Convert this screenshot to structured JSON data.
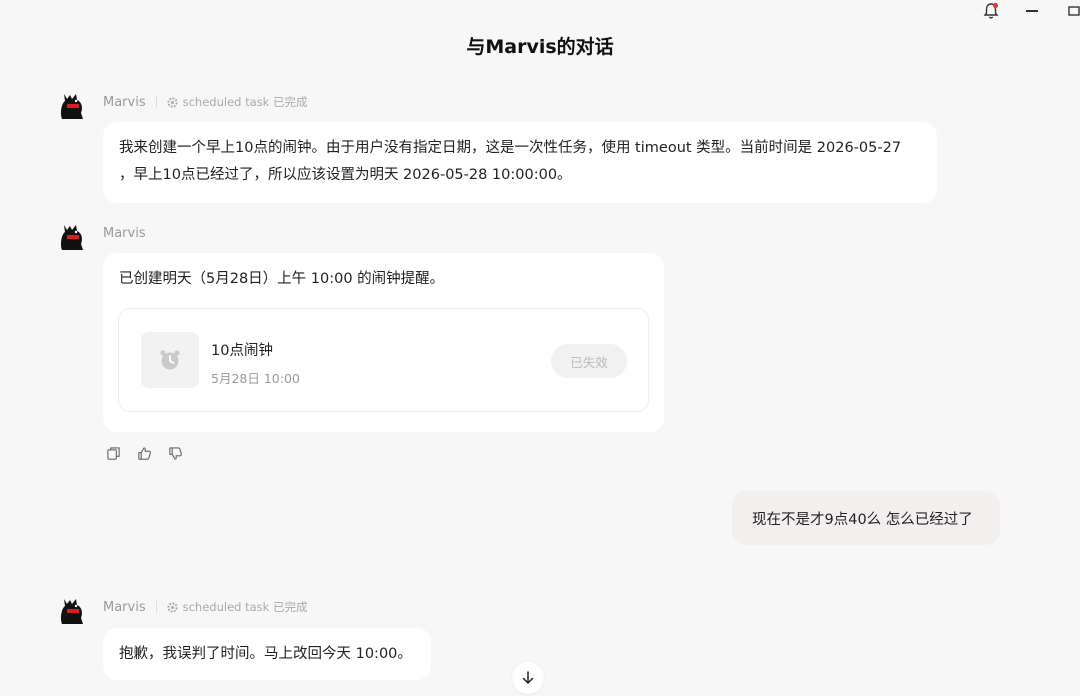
{
  "page_title": "与Marvis的对话",
  "colors": {
    "notification_dot": "#e53935",
    "user_bubble": "#f3efee",
    "card_status_bg": "#f1f1f1"
  },
  "messages": [
    {
      "sender": "Marvis",
      "task": "scheduled task 已完成",
      "lines": [
        "我来创建一个早上10点的闹钟。由于用户没有指定日期，这是一次性任务，使用 timeout 类型。当前时间是 2026-05-27",
        "，早上10点已经过了，所以应该设置为明天 2026-05-28 10:00:00。"
      ]
    },
    {
      "sender": "Marvis",
      "text": "已创建明天（5月28日）上午 10:00 的闹钟提醒。",
      "card": {
        "title": "10点闹钟",
        "subtitle": "5月28日 10:00",
        "status": "已失效",
        "icon": "alarm-clock-icon"
      }
    },
    {
      "sender": "user",
      "text": "现在不是才9点40么  怎么已经过了"
    },
    {
      "sender": "Marvis",
      "task": "scheduled task 已完成",
      "text": "抱歉，我误判了时间。马上改回今天 10:00。"
    }
  ],
  "icons": {
    "titlebar": [
      "bell-icon",
      "minimize-icon",
      "window-icon"
    ],
    "message_actions": [
      "copy-icon",
      "thumbs-up-icon",
      "thumbs-down-icon"
    ],
    "scroll": "arrow-down-icon"
  }
}
